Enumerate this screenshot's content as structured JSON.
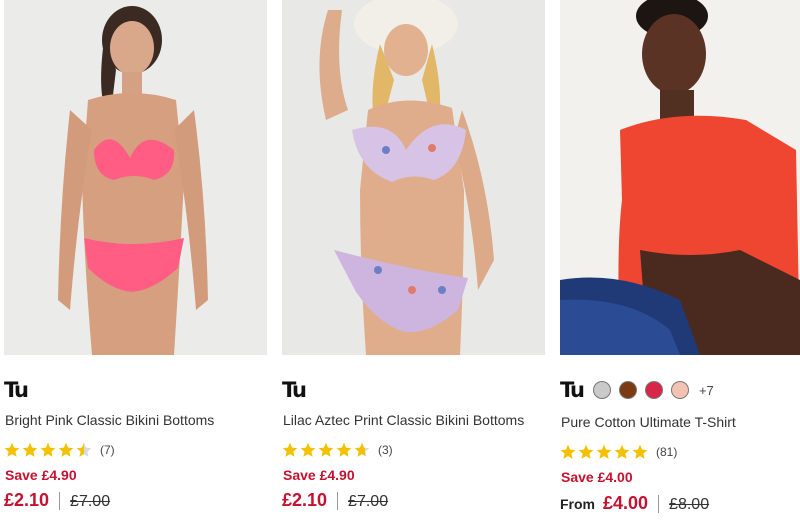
{
  "products": [
    {
      "brand": "Tu",
      "title": "Bright Pink Classic Bikini Bottoms",
      "rating": 4.5,
      "review_count": "(7)",
      "save": "Save £4.90",
      "from": "",
      "price": "£2.10",
      "was_price": "£7.00",
      "image_alt": "Model wearing bright pink bikini"
    },
    {
      "brand": "Tu",
      "title": "Lilac Aztec Print Classic Bikini Bottoms",
      "rating": 4.7,
      "review_count": "(3)",
      "save": "Save £4.90",
      "from": "",
      "price": "£2.10",
      "was_price": "£7.00",
      "image_alt": "Model wearing lilac aztec print bikini and sun hat"
    },
    {
      "brand": "Tu",
      "title": "Pure Cotton Ultimate T-Shirt",
      "rating": 5,
      "review_count": "(81)",
      "save": "Save £4.00",
      "from": "From",
      "price": "£4.00",
      "was_price": "£8.00",
      "image_alt": "Model wearing red t-shirt and jeans",
      "swatches": [
        "#c9c9c9",
        "#7a3b12",
        "#d7264a",
        "#f3c2b2"
      ],
      "more_colours": "+7"
    }
  ],
  "colors": {
    "sale_red": "#c4122f",
    "star_gold": "#f2c200"
  }
}
